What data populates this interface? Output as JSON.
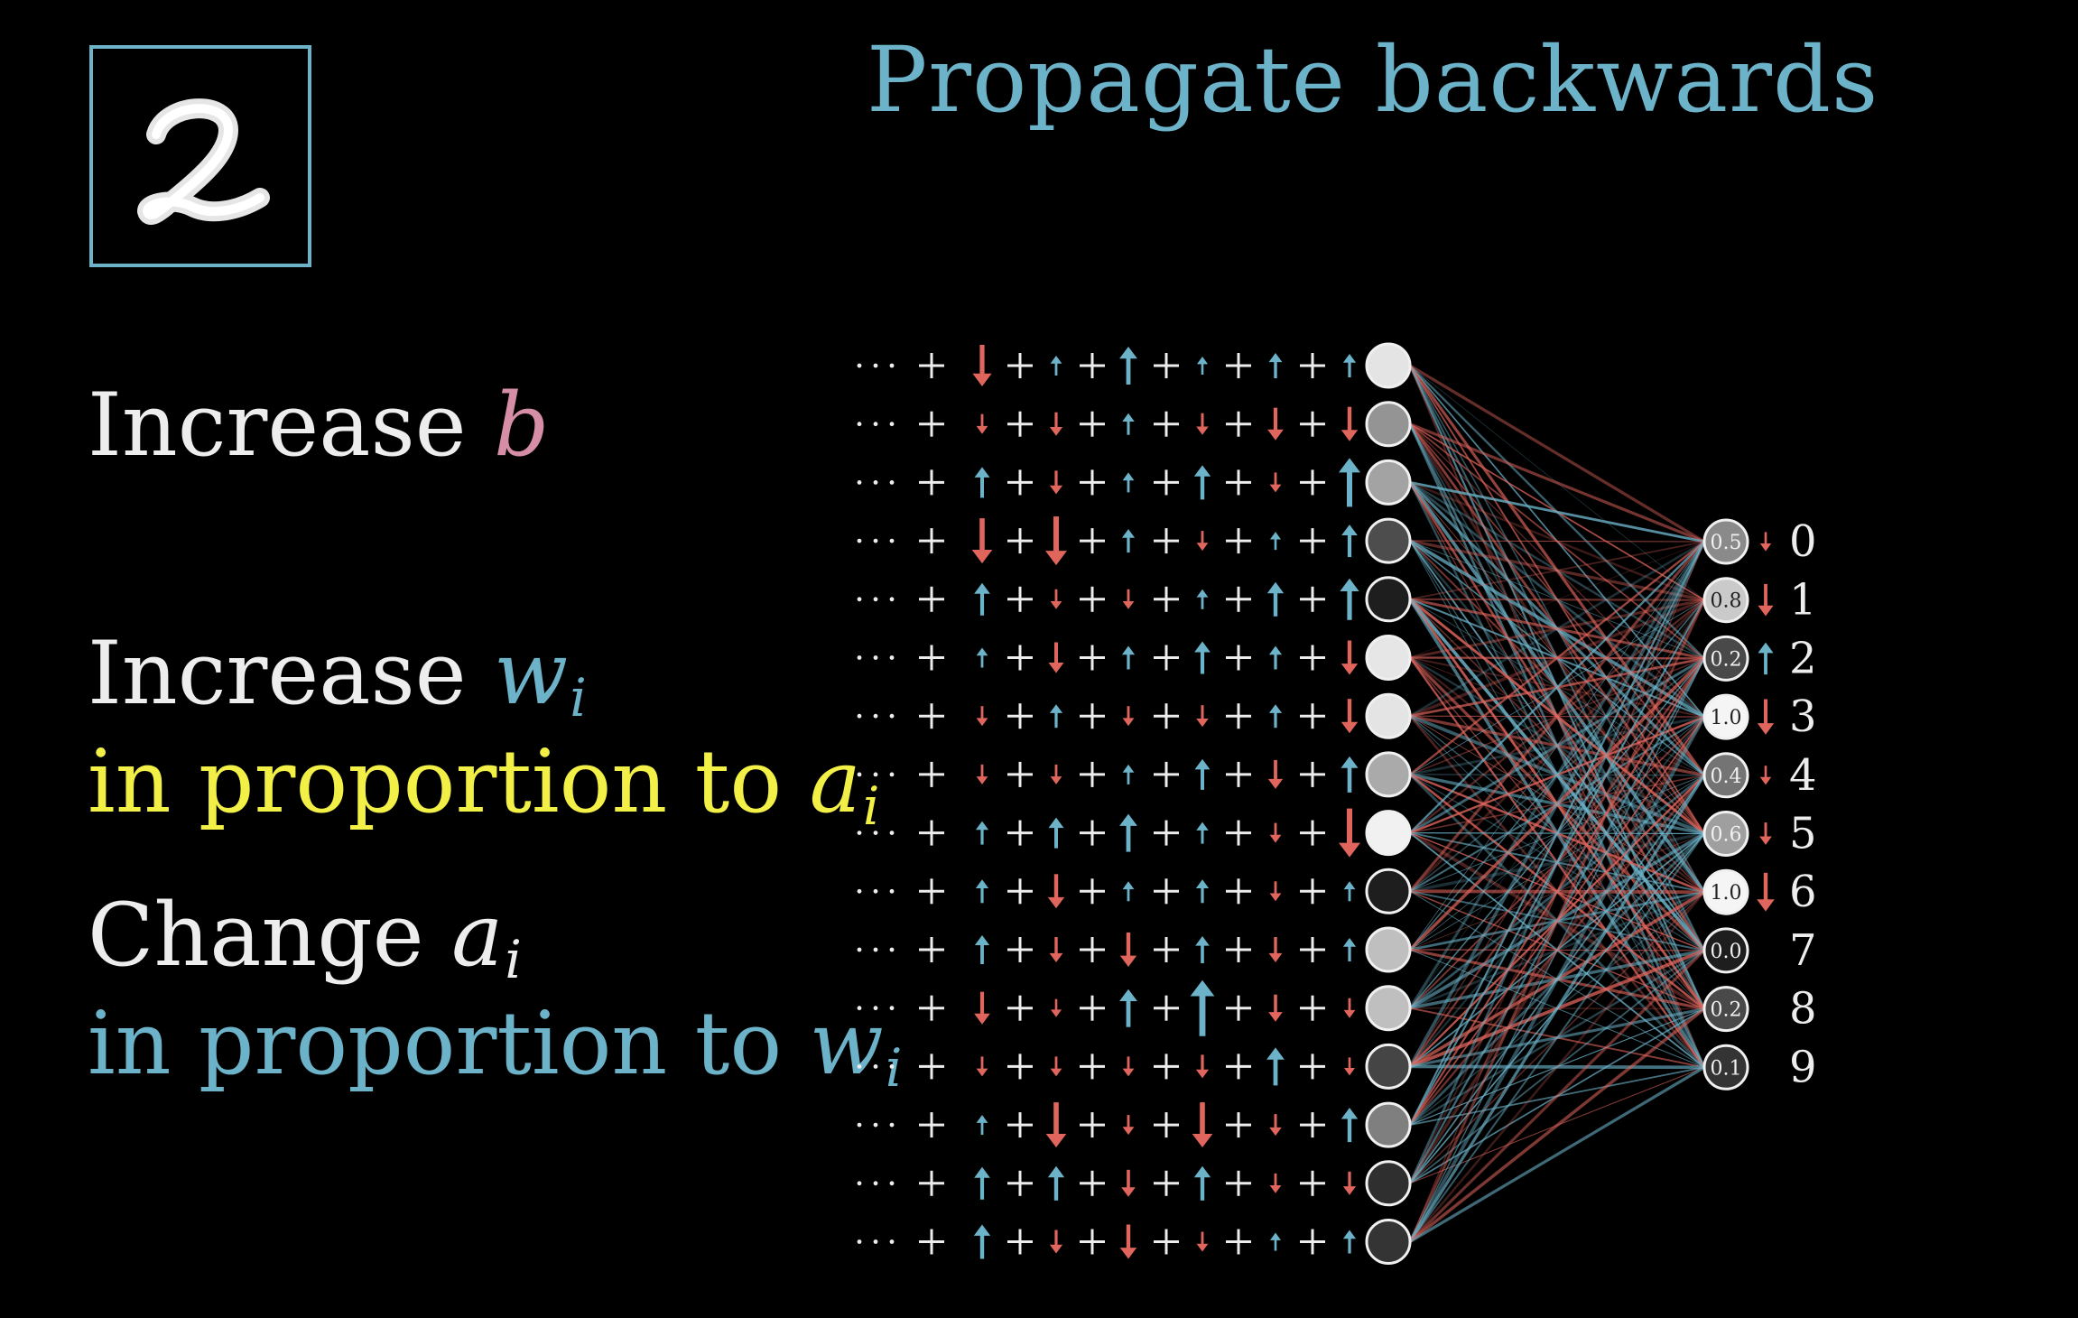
{
  "title": "Propagate backwards",
  "input_digit": "2",
  "instructions": {
    "bias": {
      "prefix": "Increase",
      "var": "b"
    },
    "weights": {
      "prefix": "Increase",
      "var": "w",
      "sub": "i",
      "line2": "in proportion to",
      "var2": "a",
      "sub2": "i"
    },
    "activations": {
      "prefix": "Change",
      "var": "a",
      "sub": "i",
      "line2": "in proportion to",
      "var2": "w",
      "sub2": "i"
    }
  },
  "colors": {
    "blue": "#6cb3c9",
    "red": "#e0655d",
    "yellow": "#f2f046",
    "pink": "#d58ea6",
    "white": "#ededed"
  },
  "hidden_layer": {
    "activations": [
      0.92,
      0.55,
      0.62,
      0.22,
      0.0,
      0.93,
      0.92,
      0.65,
      0.98,
      0.0,
      0.75,
      0.75,
      0.18,
      0.45,
      0.08,
      0.1
    ],
    "arrow_rows": [
      [
        -0.8,
        0.2,
        0.7,
        0.15,
        0.35,
        0.3
      ],
      [
        -0.2,
        -0.3,
        0.25,
        -0.25,
        -0.55,
        -0.6
      ],
      [
        0.5,
        -0.3,
        0.2,
        0.6,
        -0.2,
        1.0
      ],
      [
        -0.9,
        -1.0,
        0.3,
        -0.2,
        0.15,
        0.55
      ],
      [
        0.55,
        -0.2,
        -0.2,
        0.2,
        0.6,
        0.8
      ],
      [
        0.2,
        -0.5,
        0.3,
        0.55,
        0.3,
        -0.6
      ],
      [
        -0.2,
        0.3,
        -0.2,
        -0.25,
        0.3,
        -0.6
      ],
      [
        -0.2,
        -0.2,
        0.2,
        0.5,
        -0.45,
        0.65
      ],
      [
        0.3,
        0.5,
        0.7,
        0.25,
        -0.2,
        -1.0
      ],
      [
        0.3,
        -0.6,
        0.2,
        0.3,
        -0.2,
        0.2
      ],
      [
        0.45,
        -0.35,
        -0.6,
        0.4,
        -0.35,
        0.3
      ],
      [
        -0.55,
        -0.15,
        0.7,
        1.2,
        -0.4,
        -0.2
      ],
      [
        -0.2,
        -0.2,
        -0.2,
        -0.3,
        0.7,
        -0.15
      ],
      [
        0.2,
        -0.9,
        -0.2,
        -0.9,
        -0.25,
        0.6
      ],
      [
        0.55,
        0.6,
        -0.4,
        0.6,
        -0.2,
        -0.3
      ],
      [
        0.6,
        -0.3,
        -0.6,
        -0.2,
        0.15,
        0.3
      ]
    ]
  },
  "output_layer": {
    "neurons": [
      {
        "label": "0",
        "value": "0.5",
        "level": 0.5,
        "nudge": -0.2
      },
      {
        "label": "1",
        "value": "0.8",
        "level": 0.8,
        "nudge": -0.6
      },
      {
        "label": "2",
        "value": "0.2",
        "level": 0.2,
        "nudge": 0.6
      },
      {
        "label": "3",
        "value": "1.0",
        "level": 1.0,
        "nudge": -0.7
      },
      {
        "label": "4",
        "value": "0.4",
        "level": 0.4,
        "nudge": -0.2
      },
      {
        "label": "5",
        "value": "0.6",
        "level": 0.6,
        "nudge": -0.3
      },
      {
        "label": "6",
        "value": "1.0",
        "level": 1.0,
        "nudge": -0.8
      },
      {
        "label": "7",
        "value": "0.0",
        "level": 0.0,
        "nudge": 0
      },
      {
        "label": "8",
        "value": "0.2",
        "level": 0.2,
        "nudge": 0
      },
      {
        "label": "9",
        "value": "0.1",
        "level": 0.1,
        "nudge": 0
      }
    ]
  }
}
